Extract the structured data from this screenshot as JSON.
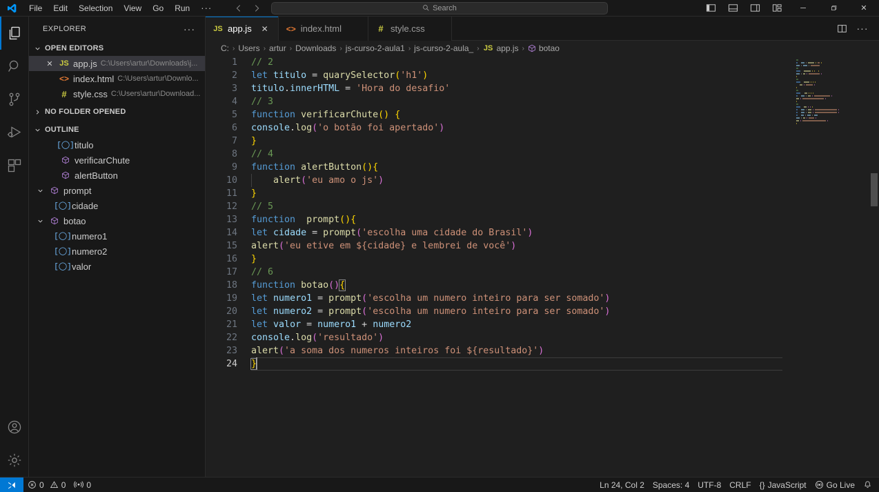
{
  "titlebar": {
    "logo_icon": "vscode-logo-icon",
    "menus": [
      {
        "label": "File"
      },
      {
        "label": "Edit"
      },
      {
        "label": "Selection"
      },
      {
        "label": "View"
      },
      {
        "label": "Go"
      },
      {
        "label": "Run"
      }
    ],
    "more_label": "···",
    "nav_back_icon": "arrow-left-icon",
    "nav_forward_icon": "arrow-right-icon",
    "search_placeholder": "Search",
    "search_icon": "search-icon",
    "layout_icons": [
      {
        "name": "toggle-primary-sidebar-icon"
      },
      {
        "name": "toggle-panel-icon"
      },
      {
        "name": "toggle-secondary-sidebar-icon"
      },
      {
        "name": "customize-layout-icon"
      }
    ],
    "window_minimize": "─",
    "window_maximize": "maximize-icon",
    "window_close": "✕"
  },
  "activitybar": {
    "items": [
      {
        "name": "explorer",
        "icon": "files-icon",
        "active": true
      },
      {
        "name": "search",
        "icon": "search-icon",
        "active": false
      },
      {
        "name": "source-control",
        "icon": "source-control-icon",
        "active": false
      },
      {
        "name": "run-and-debug",
        "icon": "run-debug-icon",
        "active": false
      },
      {
        "name": "extensions",
        "icon": "extensions-icon",
        "active": false
      }
    ],
    "bottom": [
      {
        "name": "accounts",
        "icon": "account-icon"
      },
      {
        "name": "manage",
        "icon": "gear-icon"
      }
    ]
  },
  "sidebar": {
    "title": "EXPLORER",
    "more_actions": "···",
    "sections": {
      "open_editors": {
        "label": "OPEN EDITORS",
        "expanded": true,
        "items": [
          {
            "name": "app.js",
            "path": "C:\\Users\\artur\\Downloads\\j...",
            "icon": "js",
            "icon_label": "JS",
            "selected": true,
            "close": "✕"
          },
          {
            "name": "index.html",
            "path": "C:\\Users\\artur\\Downlo...",
            "icon": "html",
            "icon_label": "<>",
            "selected": false,
            "close": "✕"
          },
          {
            "name": "style.css",
            "path": "C:\\Users\\artur\\Download...",
            "icon": "css",
            "icon_label": "#",
            "selected": false,
            "close": "✕"
          }
        ]
      },
      "no_folder": {
        "label": "NO FOLDER OPENED",
        "expanded": false
      },
      "outline": {
        "label": "OUTLINE",
        "expanded": true,
        "items": [
          {
            "label": "titulo",
            "kind": "variable",
            "depth": 1,
            "twisty": ""
          },
          {
            "label": "verificarChute",
            "kind": "function",
            "depth": 1,
            "twisty": ""
          },
          {
            "label": "alertButton",
            "kind": "function",
            "depth": 1,
            "twisty": ""
          },
          {
            "label": "prompt",
            "kind": "function",
            "depth": 1,
            "twisty": "down"
          },
          {
            "label": "cidade",
            "kind": "variable",
            "depth": 2,
            "twisty": ""
          },
          {
            "label": "botao",
            "kind": "function",
            "depth": 1,
            "twisty": "down"
          },
          {
            "label": "numero1",
            "kind": "variable",
            "depth": 2,
            "twisty": ""
          },
          {
            "label": "numero2",
            "kind": "variable",
            "depth": 2,
            "twisty": ""
          },
          {
            "label": "valor",
            "kind": "variable",
            "depth": 2,
            "twisty": ""
          }
        ]
      }
    }
  },
  "editor": {
    "tabs": [
      {
        "label": "app.js",
        "icon": "js",
        "icon_label": "JS",
        "active": true,
        "close": "✕"
      },
      {
        "label": "index.html",
        "icon": "html",
        "icon_label": "<>",
        "active": false,
        "close": "✕"
      },
      {
        "label": "style.css",
        "icon": "css",
        "icon_label": "#",
        "active": false,
        "close": "✕"
      }
    ],
    "actions": [
      {
        "name": "split-editor-right-icon"
      },
      {
        "name": "more-actions-icon",
        "label": "···"
      }
    ],
    "breadcrumb": [
      {
        "label": "C:",
        "icon": ""
      },
      {
        "label": "Users",
        "icon": ""
      },
      {
        "label": "artur",
        "icon": ""
      },
      {
        "label": "Downloads",
        "icon": ""
      },
      {
        "label": "js-curso-2-aula1",
        "icon": ""
      },
      {
        "label": "js-curso-2-aula_",
        "icon": ""
      },
      {
        "label": "app.js",
        "icon": "js"
      },
      {
        "label": "botao",
        "icon": "symbol-function"
      }
    ],
    "breadcrumb_separator": "›",
    "line_count": 24,
    "cursor_line": 24,
    "lines": [
      {
        "n": 1,
        "tokens": [
          {
            "t": "// 2",
            "c": "t-com"
          }
        ]
      },
      {
        "n": 2,
        "tokens": [
          {
            "t": "let",
            "c": "t-kw"
          },
          {
            "t": " ",
            "c": "t-op"
          },
          {
            "t": "titulo",
            "c": "t-var"
          },
          {
            "t": " = ",
            "c": "t-op"
          },
          {
            "t": "quarySelector",
            "c": "t-fn"
          },
          {
            "t": "(",
            "c": "t-pl"
          },
          {
            "t": "'h1'",
            "c": "t-str"
          },
          {
            "t": ")",
            "c": "t-pl"
          }
        ]
      },
      {
        "n": 3,
        "tokens": [
          {
            "t": "titulo",
            "c": "t-var"
          },
          {
            "t": ".",
            "c": "t-op"
          },
          {
            "t": "innerHTML",
            "c": "t-var"
          },
          {
            "t": " = ",
            "c": "t-op"
          },
          {
            "t": "'Hora do desafio'",
            "c": "t-str"
          }
        ]
      },
      {
        "n": 4,
        "tokens": [
          {
            "t": "// 3",
            "c": "t-com"
          }
        ]
      },
      {
        "n": 5,
        "tokens": [
          {
            "t": "function",
            "c": "t-kw"
          },
          {
            "t": " ",
            "c": "t-op"
          },
          {
            "t": "verificarChute",
            "c": "t-fn"
          },
          {
            "t": "(",
            "c": "t-pl"
          },
          {
            "t": ")",
            "c": "t-pl"
          },
          {
            "t": " ",
            "c": "t-op"
          },
          {
            "t": "{",
            "c": "t-pl"
          }
        ]
      },
      {
        "n": 6,
        "tokens": [
          {
            "t": "console",
            "c": "t-var"
          },
          {
            "t": ".",
            "c": "t-op"
          },
          {
            "t": "log",
            "c": "t-fn"
          },
          {
            "t": "(",
            "c": "t-p2"
          },
          {
            "t": "'o botão foi apertado'",
            "c": "t-str"
          },
          {
            "t": ")",
            "c": "t-p2"
          }
        ]
      },
      {
        "n": 7,
        "tokens": [
          {
            "t": "}",
            "c": "t-pl"
          }
        ]
      },
      {
        "n": 8,
        "tokens": [
          {
            "t": "// 4",
            "c": "t-com"
          }
        ]
      },
      {
        "n": 9,
        "tokens": [
          {
            "t": "function",
            "c": "t-kw"
          },
          {
            "t": " ",
            "c": "t-op"
          },
          {
            "t": "alertButton",
            "c": "t-fn"
          },
          {
            "t": "(",
            "c": "t-pl"
          },
          {
            "t": ")",
            "c": "t-pl"
          },
          {
            "t": "{",
            "c": "t-pl"
          }
        ]
      },
      {
        "n": 10,
        "tokens": [
          {
            "t": "    ",
            "c": "t-op"
          },
          {
            "t": "alert",
            "c": "t-fn"
          },
          {
            "t": "(",
            "c": "t-p2"
          },
          {
            "t": "'eu amo o js'",
            "c": "t-str"
          },
          {
            "t": ")",
            "c": "t-p2"
          }
        ],
        "indent_guide": true
      },
      {
        "n": 11,
        "tokens": [
          {
            "t": "}",
            "c": "t-pl"
          }
        ]
      },
      {
        "n": 12,
        "tokens": [
          {
            "t": "// 5",
            "c": "t-com"
          }
        ]
      },
      {
        "n": 13,
        "tokens": [
          {
            "t": "function",
            "c": "t-kw"
          },
          {
            "t": "  ",
            "c": "t-op"
          },
          {
            "t": "prompt",
            "c": "t-fn"
          },
          {
            "t": "(",
            "c": "t-pl"
          },
          {
            "t": ")",
            "c": "t-pl"
          },
          {
            "t": "{",
            "c": "t-pl"
          }
        ]
      },
      {
        "n": 14,
        "tokens": [
          {
            "t": "let",
            "c": "t-kw"
          },
          {
            "t": " ",
            "c": "t-op"
          },
          {
            "t": "cidade",
            "c": "t-var"
          },
          {
            "t": " = ",
            "c": "t-op"
          },
          {
            "t": "prompt",
            "c": "t-fn"
          },
          {
            "t": "(",
            "c": "t-p2"
          },
          {
            "t": "'escolha uma cidade do Brasil'",
            "c": "t-str"
          },
          {
            "t": ")",
            "c": "t-p2"
          }
        ]
      },
      {
        "n": 15,
        "tokens": [
          {
            "t": "alert",
            "c": "t-fn"
          },
          {
            "t": "(",
            "c": "t-p2"
          },
          {
            "t": "'eu etive em ${cidade} e lembrei de você'",
            "c": "t-str"
          },
          {
            "t": ")",
            "c": "t-p2"
          }
        ]
      },
      {
        "n": 16,
        "tokens": [
          {
            "t": "}",
            "c": "t-pl"
          }
        ]
      },
      {
        "n": 17,
        "tokens": [
          {
            "t": "// 6",
            "c": "t-com"
          }
        ]
      },
      {
        "n": 18,
        "tokens": [
          {
            "t": "function",
            "c": "t-kw"
          },
          {
            "t": " ",
            "c": "t-op"
          },
          {
            "t": "botao",
            "c": "t-fn"
          },
          {
            "t": "(",
            "c": "t-p2"
          },
          {
            "t": ")",
            "c": "t-p2"
          },
          {
            "t": "{",
            "c": "t-pl",
            "hl": true
          }
        ]
      },
      {
        "n": 19,
        "tokens": [
          {
            "t": "let",
            "c": "t-kw"
          },
          {
            "t": " ",
            "c": "t-op"
          },
          {
            "t": "numero1",
            "c": "t-var"
          },
          {
            "t": " = ",
            "c": "t-op"
          },
          {
            "t": "prompt",
            "c": "t-fn"
          },
          {
            "t": "(",
            "c": "t-p2"
          },
          {
            "t": "'escolha um numero inteiro para ser somado'",
            "c": "t-str"
          },
          {
            "t": ")",
            "c": "t-p2"
          }
        ]
      },
      {
        "n": 20,
        "tokens": [
          {
            "t": "let",
            "c": "t-kw"
          },
          {
            "t": " ",
            "c": "t-op"
          },
          {
            "t": "numero2",
            "c": "t-var"
          },
          {
            "t": " = ",
            "c": "t-op"
          },
          {
            "t": "prompt",
            "c": "t-fn"
          },
          {
            "t": "(",
            "c": "t-p2"
          },
          {
            "t": "'escolha um numero inteiro para ser somado'",
            "c": "t-str"
          },
          {
            "t": ")",
            "c": "t-p2"
          }
        ]
      },
      {
        "n": 21,
        "tokens": [
          {
            "t": "let",
            "c": "t-kw"
          },
          {
            "t": " ",
            "c": "t-op"
          },
          {
            "t": "valor",
            "c": "t-var"
          },
          {
            "t": " = ",
            "c": "t-op"
          },
          {
            "t": "numero1",
            "c": "t-var"
          },
          {
            "t": " + ",
            "c": "t-op"
          },
          {
            "t": "numero2",
            "c": "t-var"
          }
        ]
      },
      {
        "n": 22,
        "tokens": [
          {
            "t": "console",
            "c": "t-var"
          },
          {
            "t": ".",
            "c": "t-op"
          },
          {
            "t": "log",
            "c": "t-fn"
          },
          {
            "t": "(",
            "c": "t-p2"
          },
          {
            "t": "'resultado'",
            "c": "t-str"
          },
          {
            "t": ")",
            "c": "t-p2"
          }
        ]
      },
      {
        "n": 23,
        "tokens": [
          {
            "t": "alert",
            "c": "t-fn"
          },
          {
            "t": "(",
            "c": "t-p2"
          },
          {
            "t": "'a soma dos numeros inteiros foi ${resultado}'",
            "c": "t-str"
          },
          {
            "t": ")",
            "c": "t-p2"
          }
        ]
      },
      {
        "n": 24,
        "tokens": [
          {
            "t": "}",
            "c": "t-pl",
            "hl": true
          }
        ],
        "caret": true,
        "current": true
      }
    ]
  },
  "statusbar": {
    "remote_icon": "remote-window-icon",
    "left": [
      {
        "name": "problems",
        "icon": "error-icon",
        "errors": "0",
        "warnings": "0",
        "warn_icon": "warning-icon"
      },
      {
        "name": "ports",
        "icon": "radio-tower-icon",
        "value": "0"
      }
    ],
    "errors_count": "0",
    "warnings_count": "0",
    "ports_count": "0",
    "right": [
      {
        "name": "cursor-position",
        "label": "Ln 24, Col 2"
      },
      {
        "name": "indentation",
        "label": "Spaces: 4"
      },
      {
        "name": "encoding",
        "label": "UTF-8"
      },
      {
        "name": "eol",
        "label": "CRLF"
      },
      {
        "name": "language-mode",
        "label": "JavaScript",
        "icon": "{}"
      },
      {
        "name": "go-live",
        "label": "Go Live",
        "icon": "broadcast-icon"
      },
      {
        "name": "notifications",
        "label": "",
        "icon": "bell-icon"
      }
    ]
  },
  "colors": {
    "accent": "#0078d4",
    "editor_bg": "#1f1f1f",
    "chrome_bg": "#181818",
    "selection": "#37373d"
  }
}
